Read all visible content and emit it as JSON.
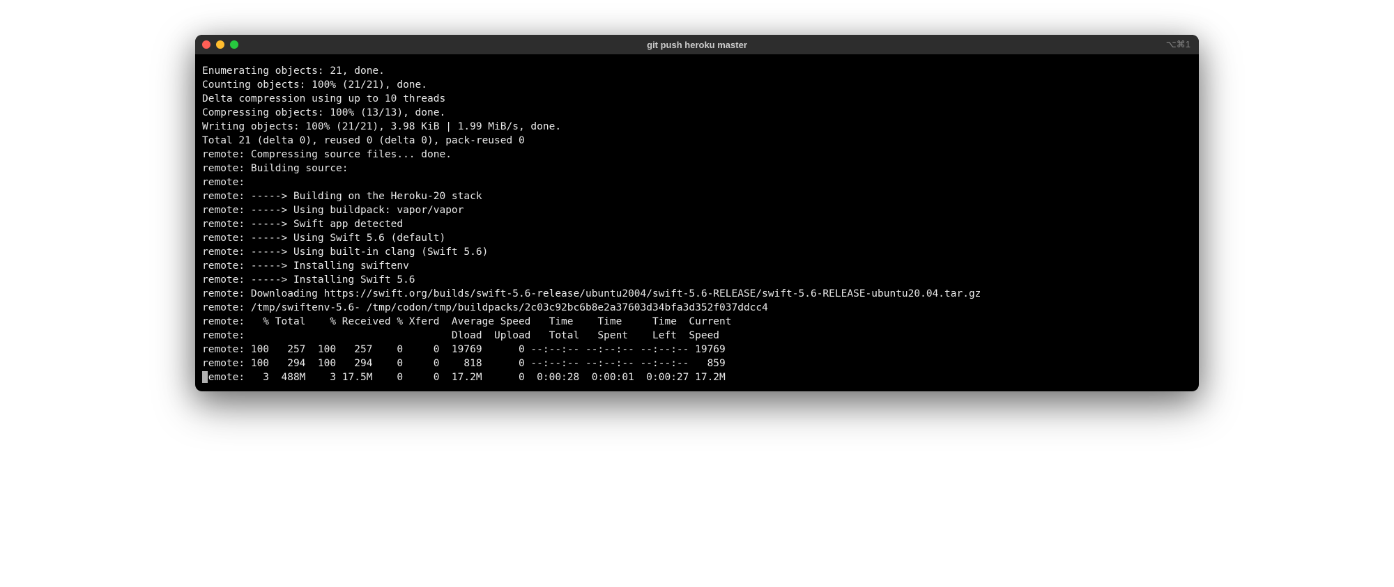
{
  "window": {
    "title": "git push heroku master",
    "shortcut": "⌥⌘1"
  },
  "terminal": {
    "lines": [
      "Enumerating objects: 21, done.",
      "Counting objects: 100% (21/21), done.",
      "Delta compression using up to 10 threads",
      "Compressing objects: 100% (13/13), done.",
      "Writing objects: 100% (21/21), 3.98 KiB | 1.99 MiB/s, done.",
      "Total 21 (delta 0), reused 0 (delta 0), pack-reused 0",
      "remote: Compressing source files... done.",
      "remote: Building source:",
      "remote: ",
      "remote: -----> Building on the Heroku-20 stack",
      "remote: -----> Using buildpack: vapor/vapor",
      "remote: -----> Swift app detected",
      "remote: -----> Using Swift 5.6 (default)",
      "remote: -----> Using built-in clang (Swift 5.6)",
      "remote: -----> Installing swiftenv",
      "remote: -----> Installing Swift 5.6",
      "remote: Downloading https://swift.org/builds/swift-5.6-release/ubuntu2004/swift-5.6-RELEASE/swift-5.6-RELEASE-ubuntu20.04.tar.gz",
      "remote: /tmp/swiftenv-5.6- /tmp/codon/tmp/buildpacks/2c03c92bc6b8e2a37603d34bfa3d352f037ddcc4",
      "remote:   % Total    % Received % Xferd  Average Speed   Time    Time     Time  Current",
      "remote:                                  Dload  Upload   Total   Spent    Left  Speed",
      "remote: 100   257  100   257    0     0  19769      0 --:--:-- --:--:-- --:--:-- 19769",
      "remote: 100   294  100   294    0     0    818      0 --:--:-- --:--:-- --:--:--   859"
    ],
    "cursor_line": "remote:   3  488M    3 17.5M    0     0  17.2M      0  0:00:28  0:00:01  0:00:27 17.2M"
  }
}
